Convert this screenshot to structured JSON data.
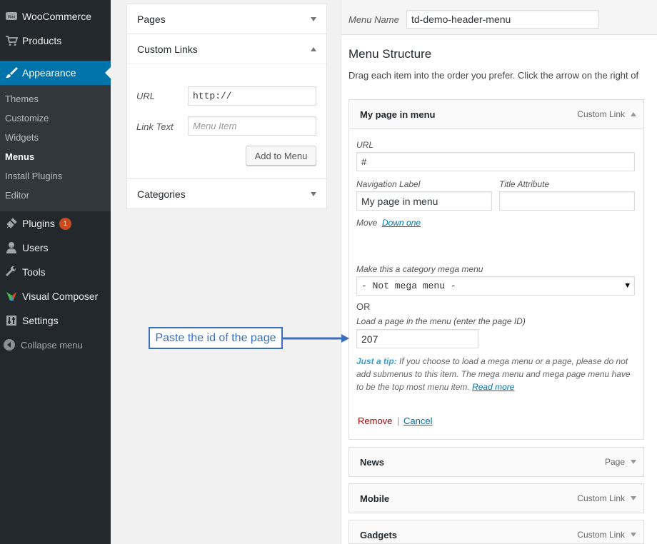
{
  "sidebar": {
    "top_items": [
      {
        "label": "WooCommerce",
        "icon": "woocommerce-icon"
      },
      {
        "label": "Products",
        "icon": "cart-icon"
      },
      {
        "label": "Appearance",
        "icon": "brush-icon"
      }
    ],
    "submenu": [
      "Themes",
      "Customize",
      "Widgets",
      "Menus",
      "Install Plugins",
      "Editor"
    ],
    "current_sub": "Menus",
    "bottom_items": [
      {
        "label": "Plugins",
        "icon": "plug-icon",
        "badge": "1"
      },
      {
        "label": "Users",
        "icon": "user-icon"
      },
      {
        "label": "Tools",
        "icon": "wrench-icon"
      },
      {
        "label": "Visual Composer",
        "icon": "visual-composer-icon"
      },
      {
        "label": "Settings",
        "icon": "settings-icon"
      }
    ],
    "collapse_label": "Collapse menu"
  },
  "add_items": {
    "pages_title": "Pages",
    "custom_links_title": "Custom Links",
    "url_label": "URL",
    "url_value": "http://",
    "link_text_label": "Link Text",
    "link_text_placeholder": "Menu Item",
    "add_button": "Add to Menu",
    "categories_title": "Categories"
  },
  "menu": {
    "name_label": "Menu Name",
    "name_value": "td-demo-header-menu",
    "structure_title": "Menu Structure",
    "instructions": "Drag each item into the order you prefer. Click the arrow on the right of",
    "items": [
      {
        "title": "My page in menu",
        "type": "Custom Link"
      },
      {
        "title": "News",
        "type": "Page"
      },
      {
        "title": "Mobile",
        "type": "Custom Link"
      },
      {
        "title": "Gadgets",
        "type": "Custom Link"
      }
    ]
  },
  "item_settings": {
    "url_label": "URL",
    "url_value": "#",
    "nav_label": "Navigation Label",
    "nav_value": "My page in menu",
    "title_attr_label": "Title Attribute",
    "title_attr_value": "",
    "move_label": "Move",
    "move_link": "Down one",
    "mega_label": "Make this a category mega menu",
    "mega_selected": "- Not mega menu -",
    "or_text": "OR",
    "page_label": "Load a page in the menu (enter the page ID)",
    "page_value": "207",
    "tip_lead": "Just a tip:",
    "tip_text": " If you choose to load a mega menu or a page, please do not add submenus to this item. The mega menu and mega page menu have to be the top most menu item. ",
    "tip_link": "Read more",
    "remove_label": "Remove",
    "cancel_label": "Cancel"
  },
  "callout": {
    "text": "Paste the id of the page"
  },
  "colors": {
    "sidebar_bg": "#23282d",
    "submenu_bg": "#32373c",
    "accent": "#0073aa",
    "badge": "#ca4a1f",
    "callout": "#3a6fbf",
    "remove": "#a00"
  }
}
